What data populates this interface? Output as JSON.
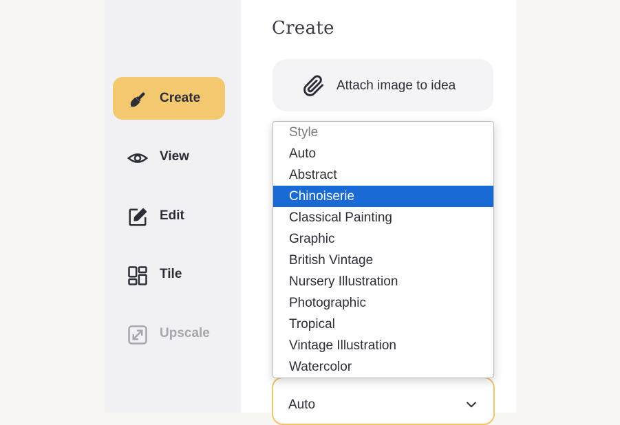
{
  "sidebar": {
    "items": [
      {
        "label": "Create",
        "icon": "paintbrush-icon",
        "active": true
      },
      {
        "label": "View",
        "icon": "eye-icon"
      },
      {
        "label": "Edit",
        "icon": "edit-icon"
      },
      {
        "label": "Tile",
        "icon": "tile-grid-icon"
      },
      {
        "label": "Upscale",
        "icon": "upscale-icon",
        "disabled": true
      }
    ]
  },
  "main": {
    "title": "Create",
    "attach_button": {
      "label": "Attach image to idea",
      "icon": "paperclip-icon"
    },
    "style_select": {
      "selected_value": "Auto",
      "header": "Style",
      "options": [
        "Auto",
        "Abstract",
        "Chinoiserie",
        "Classical Painting",
        "Graphic",
        "British Vintage",
        "Nursery Illustration",
        "Photographic",
        "Tropical",
        "Vintage Illustration",
        "Watercolor"
      ],
      "highlighted": "Chinoiserie"
    }
  },
  "colors": {
    "active_nav": "#f4c86e",
    "highlight": "#1a6ad6",
    "select_border": "#f0c569"
  }
}
